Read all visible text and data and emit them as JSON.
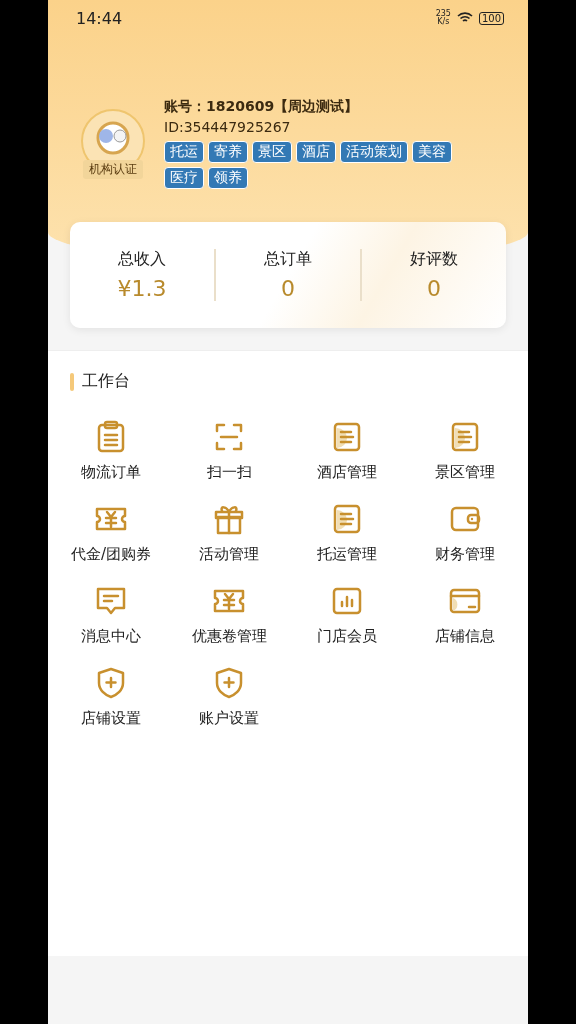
{
  "status_bar": {
    "time": "14:44",
    "speed": "235\nK/s",
    "battery": "100"
  },
  "profile": {
    "badge": "机构认证",
    "account": "账号：1820609【周边测试】",
    "id": "ID:354447925267",
    "tags": [
      "托运",
      "寄养",
      "景区",
      "酒店",
      "活动策划",
      "美容",
      "医疗",
      "领养"
    ]
  },
  "stats": [
    {
      "label": "总收入",
      "value": "¥1.3"
    },
    {
      "label": "总订单",
      "value": "0"
    },
    {
      "label": "好评数",
      "value": "0"
    }
  ],
  "workbench": {
    "title": "工作台",
    "items": [
      {
        "label": "物流订单",
        "kind": "clipboard"
      },
      {
        "label": "扫一扫",
        "kind": "scan"
      },
      {
        "label": "酒店管理",
        "kind": "document"
      },
      {
        "label": "景区管理",
        "kind": "document"
      },
      {
        "label": "代金/团购券",
        "kind": "ticket"
      },
      {
        "label": "活动管理",
        "kind": "gift"
      },
      {
        "label": "托运管理",
        "kind": "document"
      },
      {
        "label": "财务管理",
        "kind": "wallet"
      },
      {
        "label": "消息中心",
        "kind": "message"
      },
      {
        "label": "优惠卷管理",
        "kind": "ticket"
      },
      {
        "label": "门店会员",
        "kind": "chart"
      },
      {
        "label": "店铺信息",
        "kind": "card"
      },
      {
        "label": "店铺设置",
        "kind": "shield"
      },
      {
        "label": "账户设置",
        "kind": "shield"
      }
    ]
  }
}
